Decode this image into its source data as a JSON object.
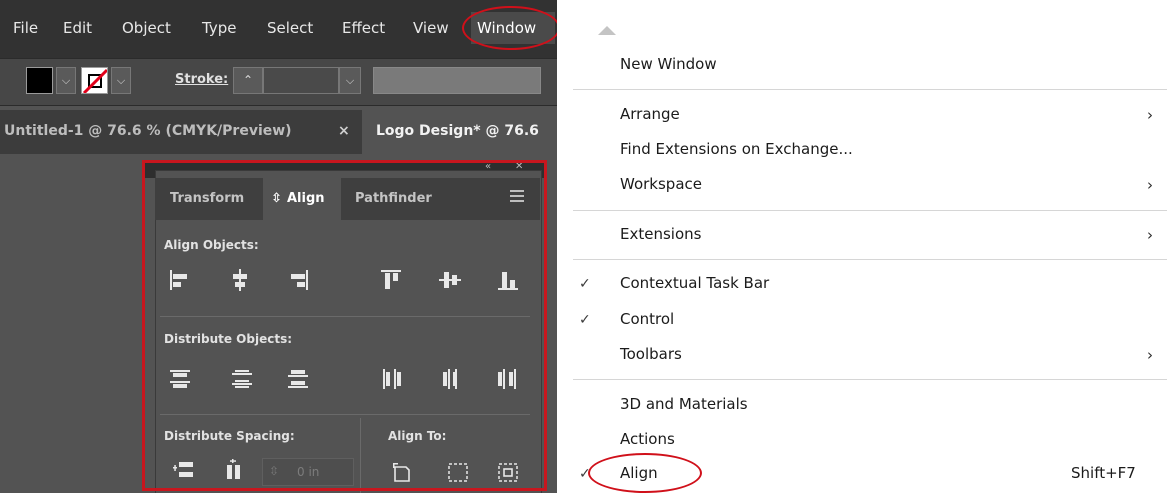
{
  "menubar": {
    "items": [
      "File",
      "Edit",
      "Object",
      "Type",
      "Select",
      "Effect",
      "View",
      "Window"
    ]
  },
  "controlbar": {
    "stroke_label": "Stroke:",
    "fill_color": "#000000",
    "stroke_color": "#ffffff"
  },
  "document_tabs": [
    {
      "label": "Untitled-1 @ 76.6 % (CMYK/Preview)",
      "close": "×"
    },
    {
      "label": "Logo Design* @ 76.6"
    }
  ],
  "align_panel": {
    "tabs": [
      "Transform",
      "Align",
      "Pathfinder"
    ],
    "align_objects_label": "Align Objects:",
    "distribute_objects_label": "Distribute Objects:",
    "distribute_spacing_label": "Distribute Spacing:",
    "align_to_label": "Align To:",
    "spacing_value": "0 in",
    "align_icons": [
      "horizontal-align-left-icon",
      "horizontal-align-center-icon",
      "horizontal-align-right-icon",
      "vertical-align-top-icon",
      "vertical-align-center-icon",
      "vertical-align-bottom-icon"
    ],
    "distribute_icons": [
      "vertical-distribute-top-icon",
      "vertical-distribute-center-icon",
      "vertical-distribute-bottom-icon",
      "horizontal-distribute-left-icon",
      "horizontal-distribute-center-icon",
      "horizontal-distribute-right-icon"
    ]
  },
  "window_menu": {
    "items": [
      {
        "label": "New Window"
      },
      {
        "label": "Arrange",
        "submenu": true
      },
      {
        "label": "Find Extensions on Exchange..."
      },
      {
        "label": "Workspace",
        "submenu": true
      },
      {
        "label": "Extensions",
        "submenu": true
      },
      {
        "label": "Contextual Task Bar",
        "checked": true
      },
      {
        "label": "Control",
        "checked": true
      },
      {
        "label": "Toolbars",
        "submenu": true
      },
      {
        "label": "3D and Materials"
      },
      {
        "label": "Actions"
      },
      {
        "label": "Align",
        "checked": true,
        "shortcut": "Shift+F7"
      }
    ]
  },
  "colors": {
    "highlight": "#d0101a",
    "panel_bg": "#535353",
    "menubar_bg": "#323232"
  }
}
